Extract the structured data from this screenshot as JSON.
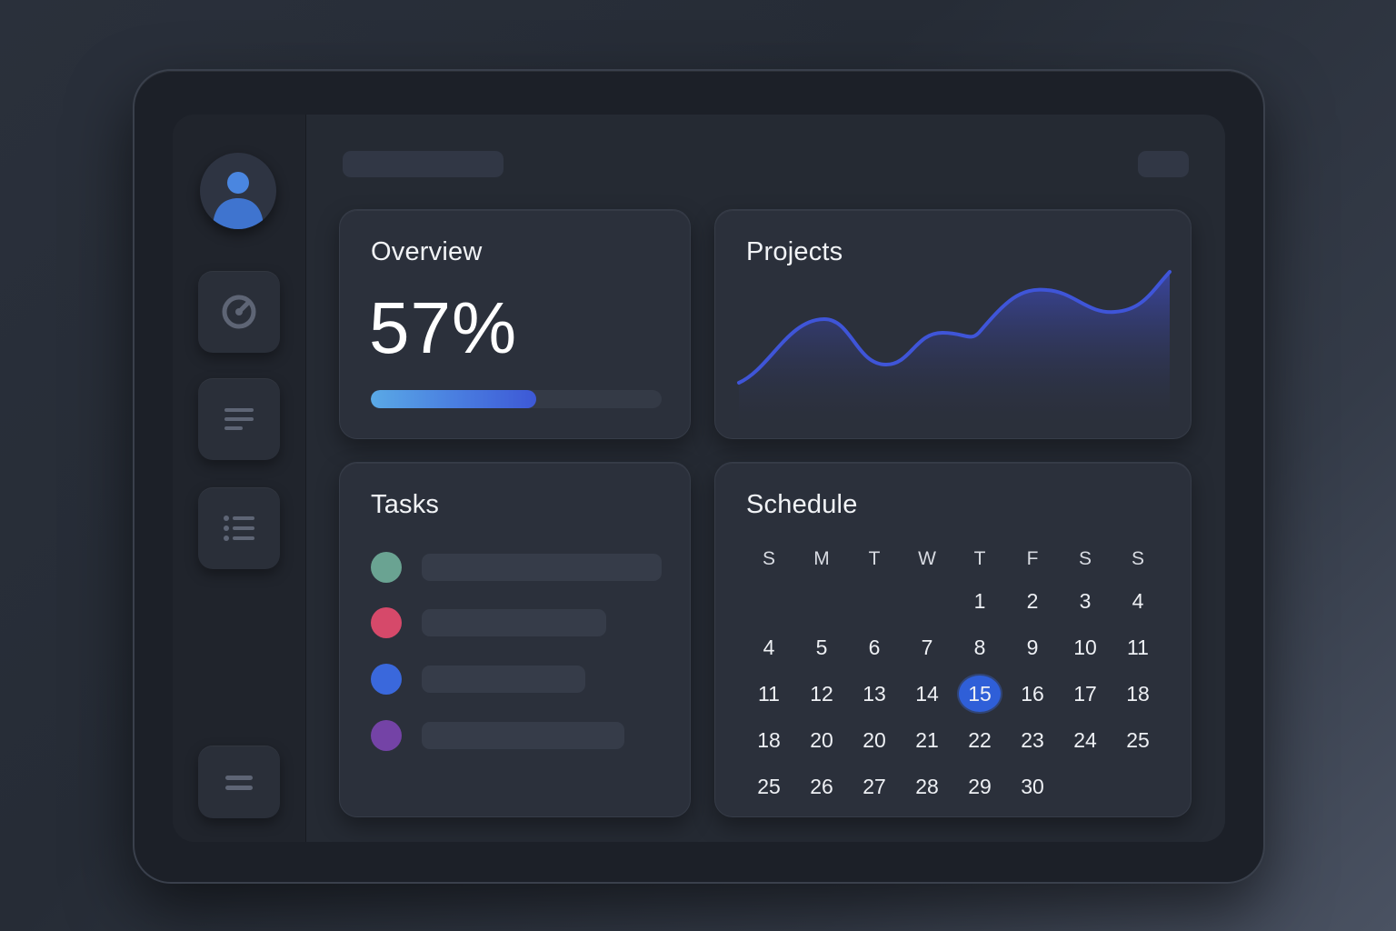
{
  "overview": {
    "title": "Overview",
    "value_label": "57%",
    "progress": 0.57
  },
  "projects": {
    "title": "Projects"
  },
  "tasks": {
    "title": "Tasks",
    "items": [
      {
        "color": "#6aa392"
      },
      {
        "color": "#d6496a"
      },
      {
        "color": "#3a68dc"
      },
      {
        "color": "#7443a6"
      }
    ]
  },
  "schedule": {
    "title": "Schedule",
    "weekdays": [
      "S",
      "M",
      "T",
      "W",
      "T",
      "F",
      "S",
      "S"
    ],
    "rows": [
      [
        "",
        "",
        "",
        "",
        "1",
        "2",
        "3",
        "4"
      ],
      [
        "4",
        "5",
        "6",
        "7",
        "8",
        "9",
        "10",
        "11"
      ],
      [
        "11",
        "12",
        "13",
        "14",
        "15",
        "16",
        "17",
        "18"
      ],
      [
        "18",
        "20",
        "20",
        "21",
        "22",
        "23",
        "24",
        "25"
      ],
      [
        "25",
        "26",
        "27",
        "28",
        "29",
        "30",
        "",
        ""
      ]
    ],
    "selected_day": "15"
  },
  "sidebar": {
    "items": [
      {
        "icon": "gauge-icon"
      },
      {
        "icon": "document-lines-icon"
      },
      {
        "icon": "list-icon"
      }
    ],
    "bottom_icon": "menu-icon"
  },
  "colors": {
    "accent": "#3d58d6",
    "chart_line": "#3f55d8",
    "selected_day": "#2f5fd8"
  }
}
